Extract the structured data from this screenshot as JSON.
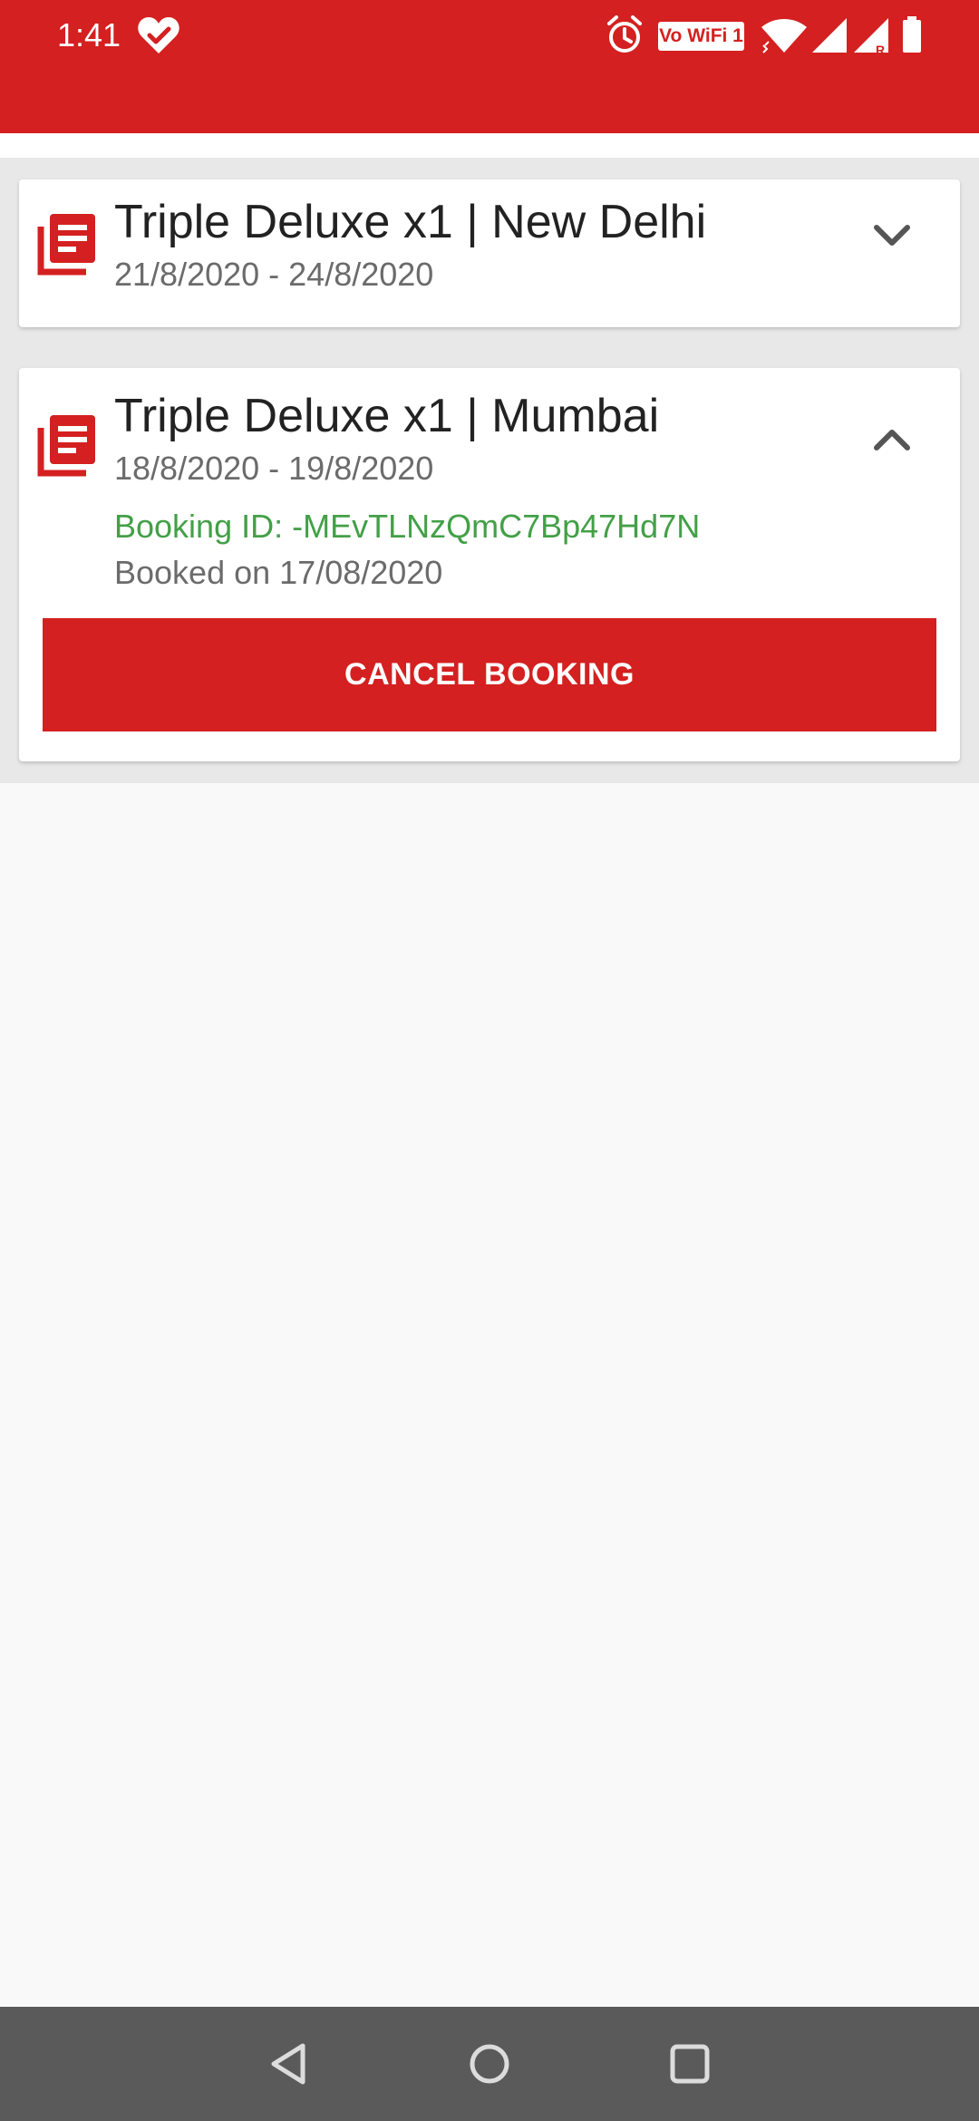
{
  "status_bar": {
    "time": "1:41",
    "wifi_badge": "Vo WiFi 1",
    "icons": [
      "heart-check-icon",
      "alarm-icon",
      "wifi-icon",
      "signal-icon",
      "signal-roaming-icon",
      "battery-icon"
    ],
    "background": "#d42020"
  },
  "bookings": [
    {
      "title": "Triple Deluxe x1 | New Delhi",
      "dates": "21/8/2020 - 24/8/2020",
      "expanded": false,
      "icon": "booking-list-icon"
    },
    {
      "title": "Triple Deluxe x1 | Mumbai",
      "dates": "18/8/2020 - 19/8/2020",
      "expanded": true,
      "booking_id": "Booking ID: -MEvTLNzQmC7Bp47Hd7N",
      "booked_on": "Booked on 17/08/2020",
      "cancel_label": "CANCEL BOOKING",
      "icon": "booking-list-icon"
    }
  ],
  "colors": {
    "accent": "#d42020",
    "booking_id_green": "#43a047",
    "nav_bar": "#5a5a5a"
  },
  "nav_bar": {
    "icons": [
      "back-icon",
      "home-icon",
      "recents-icon"
    ]
  }
}
